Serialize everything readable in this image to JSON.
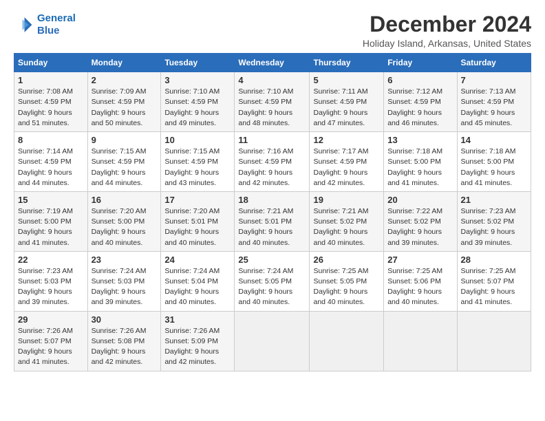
{
  "logo": {
    "line1": "General",
    "line2": "Blue"
  },
  "title": "December 2024",
  "subtitle": "Holiday Island, Arkansas, United States",
  "weekdays": [
    "Sunday",
    "Monday",
    "Tuesday",
    "Wednesday",
    "Thursday",
    "Friday",
    "Saturday"
  ],
  "weeks": [
    [
      {
        "day": "1",
        "info": "Sunrise: 7:08 AM\nSunset: 4:59 PM\nDaylight: 9 hours\nand 51 minutes."
      },
      {
        "day": "2",
        "info": "Sunrise: 7:09 AM\nSunset: 4:59 PM\nDaylight: 9 hours\nand 50 minutes."
      },
      {
        "day": "3",
        "info": "Sunrise: 7:10 AM\nSunset: 4:59 PM\nDaylight: 9 hours\nand 49 minutes."
      },
      {
        "day": "4",
        "info": "Sunrise: 7:10 AM\nSunset: 4:59 PM\nDaylight: 9 hours\nand 48 minutes."
      },
      {
        "day": "5",
        "info": "Sunrise: 7:11 AM\nSunset: 4:59 PM\nDaylight: 9 hours\nand 47 minutes."
      },
      {
        "day": "6",
        "info": "Sunrise: 7:12 AM\nSunset: 4:59 PM\nDaylight: 9 hours\nand 46 minutes."
      },
      {
        "day": "7",
        "info": "Sunrise: 7:13 AM\nSunset: 4:59 PM\nDaylight: 9 hours\nand 45 minutes."
      }
    ],
    [
      {
        "day": "8",
        "info": "Sunrise: 7:14 AM\nSunset: 4:59 PM\nDaylight: 9 hours\nand 44 minutes."
      },
      {
        "day": "9",
        "info": "Sunrise: 7:15 AM\nSunset: 4:59 PM\nDaylight: 9 hours\nand 44 minutes."
      },
      {
        "day": "10",
        "info": "Sunrise: 7:15 AM\nSunset: 4:59 PM\nDaylight: 9 hours\nand 43 minutes."
      },
      {
        "day": "11",
        "info": "Sunrise: 7:16 AM\nSunset: 4:59 PM\nDaylight: 9 hours\nand 42 minutes."
      },
      {
        "day": "12",
        "info": "Sunrise: 7:17 AM\nSunset: 4:59 PM\nDaylight: 9 hours\nand 42 minutes."
      },
      {
        "day": "13",
        "info": "Sunrise: 7:18 AM\nSunset: 5:00 PM\nDaylight: 9 hours\nand 41 minutes."
      },
      {
        "day": "14",
        "info": "Sunrise: 7:18 AM\nSunset: 5:00 PM\nDaylight: 9 hours\nand 41 minutes."
      }
    ],
    [
      {
        "day": "15",
        "info": "Sunrise: 7:19 AM\nSunset: 5:00 PM\nDaylight: 9 hours\nand 41 minutes."
      },
      {
        "day": "16",
        "info": "Sunrise: 7:20 AM\nSunset: 5:00 PM\nDaylight: 9 hours\nand 40 minutes."
      },
      {
        "day": "17",
        "info": "Sunrise: 7:20 AM\nSunset: 5:01 PM\nDaylight: 9 hours\nand 40 minutes."
      },
      {
        "day": "18",
        "info": "Sunrise: 7:21 AM\nSunset: 5:01 PM\nDaylight: 9 hours\nand 40 minutes."
      },
      {
        "day": "19",
        "info": "Sunrise: 7:21 AM\nSunset: 5:02 PM\nDaylight: 9 hours\nand 40 minutes."
      },
      {
        "day": "20",
        "info": "Sunrise: 7:22 AM\nSunset: 5:02 PM\nDaylight: 9 hours\nand 39 minutes."
      },
      {
        "day": "21",
        "info": "Sunrise: 7:23 AM\nSunset: 5:02 PM\nDaylight: 9 hours\nand 39 minutes."
      }
    ],
    [
      {
        "day": "22",
        "info": "Sunrise: 7:23 AM\nSunset: 5:03 PM\nDaylight: 9 hours\nand 39 minutes."
      },
      {
        "day": "23",
        "info": "Sunrise: 7:24 AM\nSunset: 5:03 PM\nDaylight: 9 hours\nand 39 minutes."
      },
      {
        "day": "24",
        "info": "Sunrise: 7:24 AM\nSunset: 5:04 PM\nDaylight: 9 hours\nand 40 minutes."
      },
      {
        "day": "25",
        "info": "Sunrise: 7:24 AM\nSunset: 5:05 PM\nDaylight: 9 hours\nand 40 minutes."
      },
      {
        "day": "26",
        "info": "Sunrise: 7:25 AM\nSunset: 5:05 PM\nDaylight: 9 hours\nand 40 minutes."
      },
      {
        "day": "27",
        "info": "Sunrise: 7:25 AM\nSunset: 5:06 PM\nDaylight: 9 hours\nand 40 minutes."
      },
      {
        "day": "28",
        "info": "Sunrise: 7:25 AM\nSunset: 5:07 PM\nDaylight: 9 hours\nand 41 minutes."
      }
    ],
    [
      {
        "day": "29",
        "info": "Sunrise: 7:26 AM\nSunset: 5:07 PM\nDaylight: 9 hours\nand 41 minutes."
      },
      {
        "day": "30",
        "info": "Sunrise: 7:26 AM\nSunset: 5:08 PM\nDaylight: 9 hours\nand 42 minutes."
      },
      {
        "day": "31",
        "info": "Sunrise: 7:26 AM\nSunset: 5:09 PM\nDaylight: 9 hours\nand 42 minutes."
      },
      null,
      null,
      null,
      null
    ]
  ]
}
